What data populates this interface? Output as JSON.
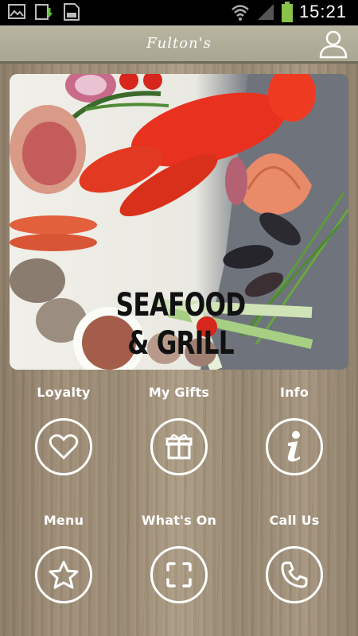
{
  "status_bar": {
    "time": "15:21",
    "icons": [
      "gallery-icon",
      "download-icon",
      "sd-card-icon",
      "wifi-icon",
      "signal-icon",
      "battery-icon"
    ]
  },
  "header": {
    "title": "Fulton's",
    "profile_icon": "user-icon"
  },
  "banner": {
    "line1": "SEAFOOD",
    "line2": "& GRILL"
  },
  "tiles": [
    {
      "label": "Loyalty",
      "icon": "heart-icon"
    },
    {
      "label": "My Gifts",
      "icon": "gift-icon"
    },
    {
      "label": "Info",
      "icon": "info-icon"
    },
    {
      "label": "Menu",
      "icon": "star-icon"
    },
    {
      "label": "What's On",
      "icon": "scan-icon"
    },
    {
      "label": "Call Us",
      "icon": "phone-icon"
    }
  ],
  "colors": {
    "header": "#b0ae98",
    "status_bar": "#000000",
    "battery": "#8bc34a",
    "icon_stroke": "#ffffff"
  }
}
